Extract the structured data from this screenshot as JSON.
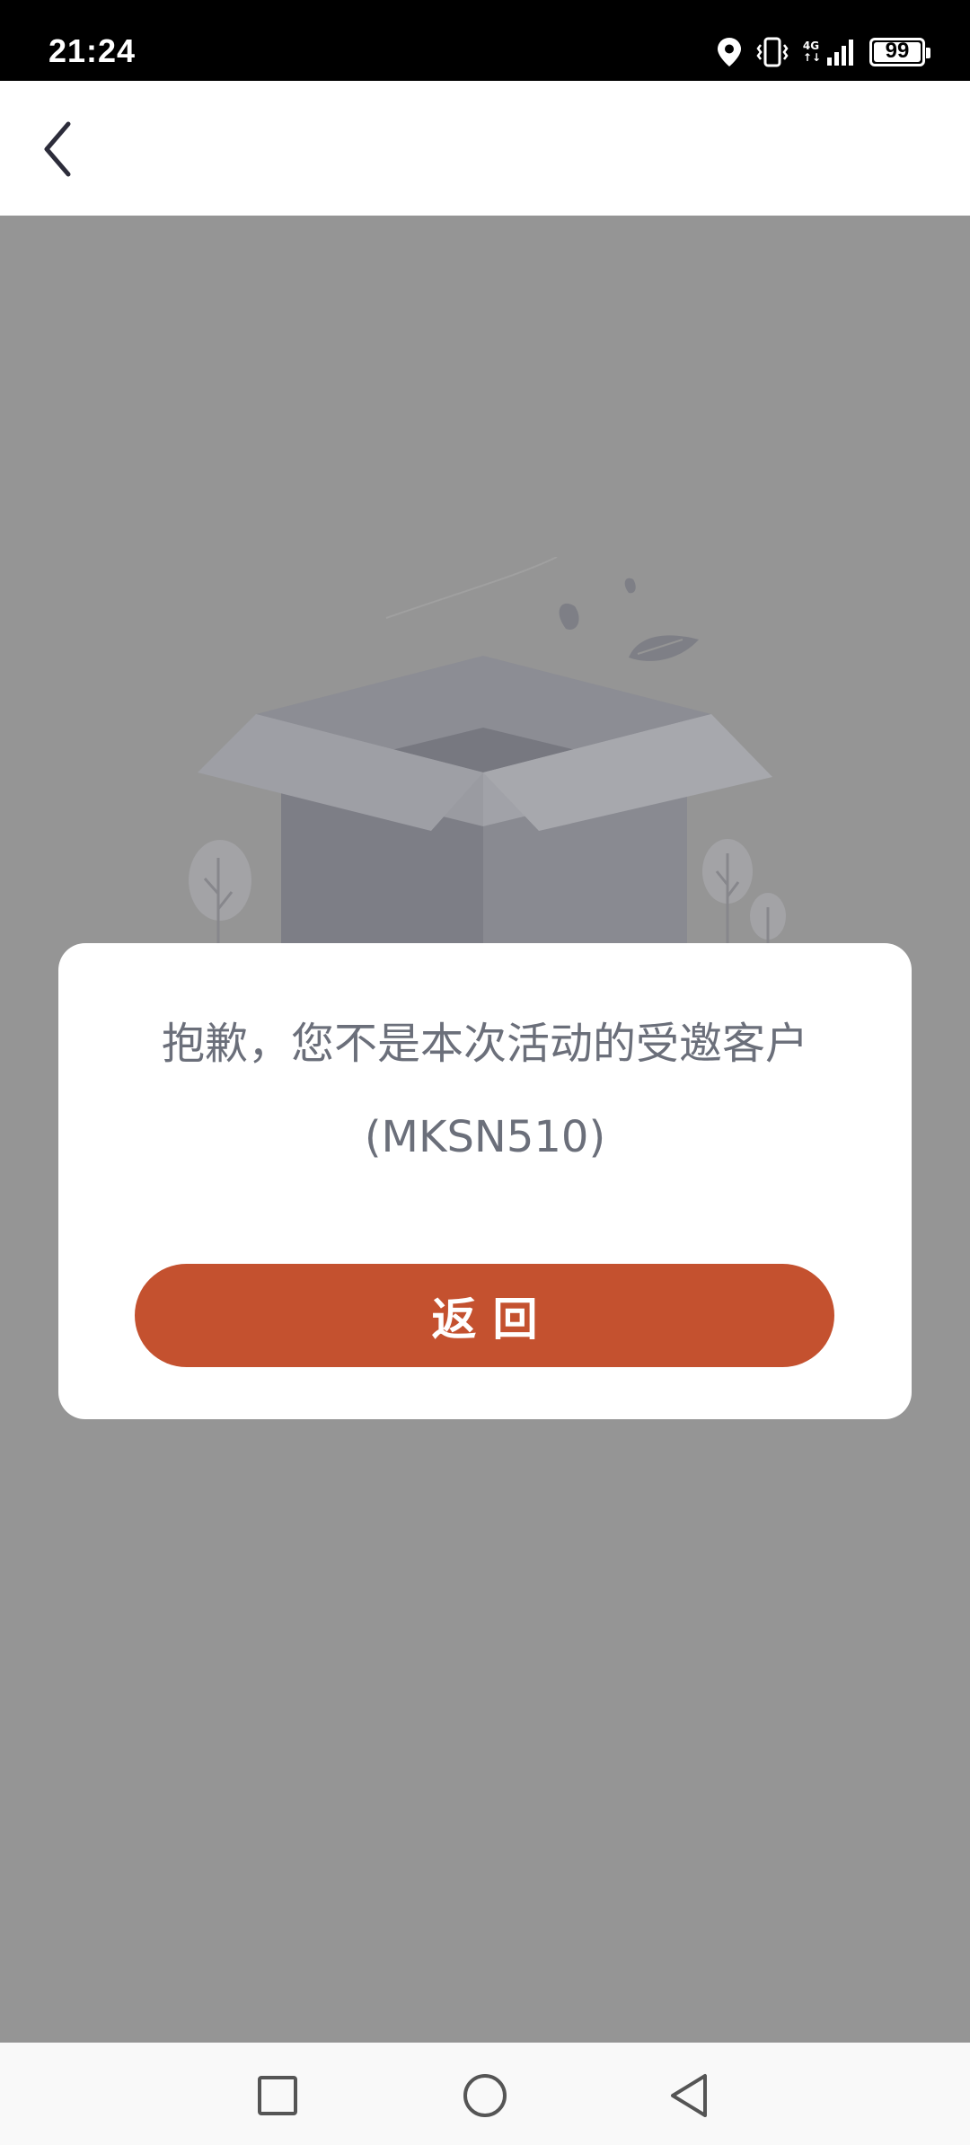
{
  "status_bar": {
    "time": "21:24",
    "network_label_top": "4G",
    "network_label_bottom": "↑↓",
    "battery_level": "99",
    "icons": [
      "location-icon",
      "vibrate-icon",
      "signal-icon",
      "battery-icon"
    ]
  },
  "header": {
    "back_icon": "chevron-left-icon"
  },
  "illustration": {
    "icon": "empty-box-illustration"
  },
  "dialog": {
    "message_line1": "抱歉，您不是本次活动的受邀客户",
    "message_line2": "(MKSN510)",
    "button_label": "返回",
    "button_color": "#c4512f"
  },
  "nav_bar": {
    "icons": [
      "square-recents-icon",
      "circle-home-icon",
      "triangle-back-icon"
    ]
  },
  "colors": {
    "overlay": "#959595",
    "text_gray": "#6b6f7a",
    "accent": "#c4512f"
  }
}
